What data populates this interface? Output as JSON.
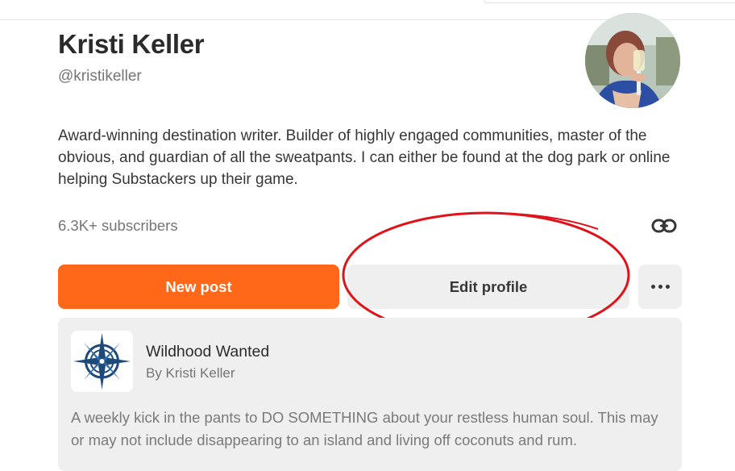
{
  "profile": {
    "name": "Kristi Keller",
    "handle": "@kristikeller",
    "bio": "Award-winning destination writer. Builder of highly engaged communities, master of the obvious, and guardian of all the sweatpants. I can either be found at the dog park or online helping Substackers up their game.",
    "subscribers": "6.3K+ subscribers",
    "avatar_icon": "profile-photo"
  },
  "actions": {
    "new_post_label": "New post",
    "edit_profile_label": "Edit profile",
    "more_icon": "ellipsis-icon",
    "link_icon": "link-icon"
  },
  "colors": {
    "accent": "#ff6719",
    "secondary_button": "#efefef",
    "annotation": "#e0121a"
  },
  "publication": {
    "title": "Wildhood Wanted",
    "author": "By Kristi Keller",
    "description": "A weekly kick in the pants to DO SOMETHING about your restless human soul. This may or may not include disappearing to an island and living off coconuts and rum.",
    "logo_icon": "compass-rose-icon"
  }
}
